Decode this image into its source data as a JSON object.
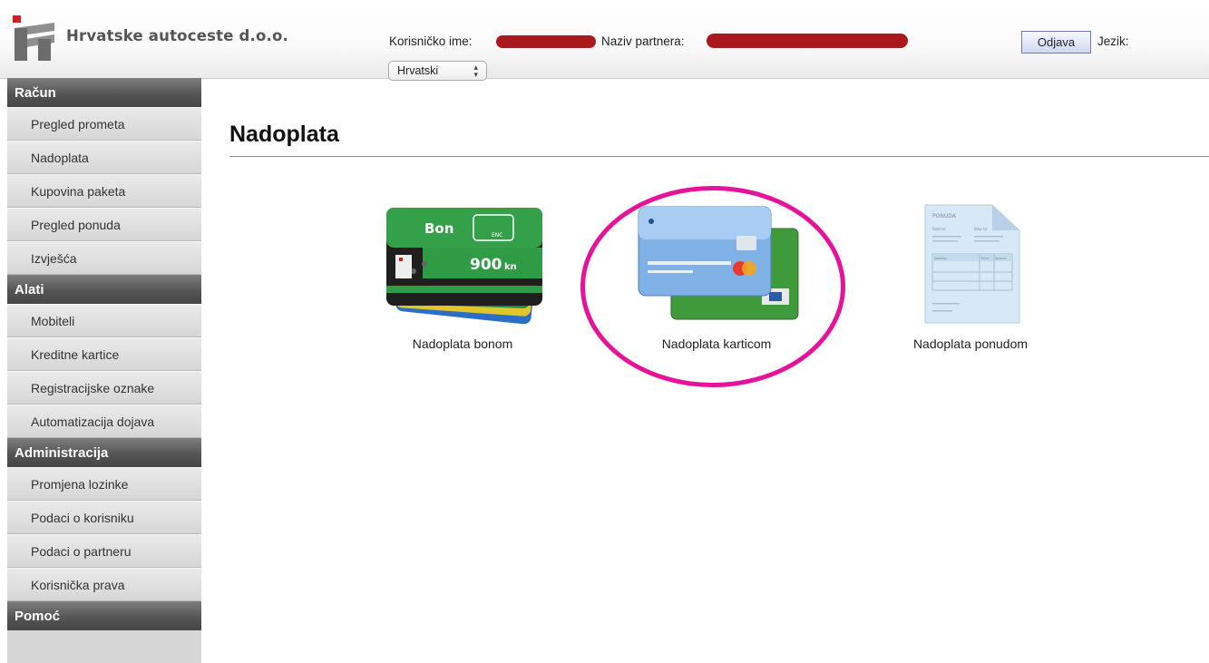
{
  "header": {
    "company_name": "Hrvatske autoceste d.o.o.",
    "username_label": "Korisničko ime:",
    "username_value": "",
    "partner_label": "Naziv partnera:",
    "partner_value": "",
    "logout_label": "Odjava",
    "language_label": "Jezik:",
    "language_selected": "Hrvatski"
  },
  "sidebar": {
    "sections": [
      {
        "title": "Račun",
        "items": [
          "Pregled prometa",
          "Nadoplata",
          "Kupovina paketa",
          "Pregled ponuda",
          "Izvješća"
        ]
      },
      {
        "title": "Alati",
        "items": [
          "Mobiteli",
          "Kreditne kartice",
          "Registracijske oznake",
          "Automatizacija dojava"
        ]
      },
      {
        "title": "Administracija",
        "items": [
          "Promjena lozinke",
          "Podaci o korisniku",
          "Podaci o partneru",
          "Korisnička prava"
        ]
      },
      {
        "title": "Pomoć",
        "items": []
      }
    ]
  },
  "main": {
    "title": "Nadoplata",
    "options": [
      {
        "label": "Nadoplata bonom",
        "card_text_brand": "Bon",
        "card_text_amount": "900",
        "card_text_currency": "kn",
        "card_text_tag": "ENC",
        "icon": "voucher-card-icon"
      },
      {
        "label": "Nadoplata karticom",
        "icon": "credit-card-icon",
        "highlighted": true
      },
      {
        "label": "Nadoplata ponudom",
        "doc_title": "PONUDA",
        "doc_sold_to": "Sold to:",
        "doc_ship_to": "Ship to:",
        "doc_col_quantity": "Quantity",
        "doc_col_price": "Price",
        "doc_col_amount": "Amount",
        "icon": "invoice-document-icon"
      }
    ]
  },
  "colors": {
    "highlight": "#e6139a",
    "sidebar_header": "#555555",
    "sidebar_item": "#d6d6d6",
    "redaction": "#a8181c",
    "logo_red": "#d21f1f"
  }
}
